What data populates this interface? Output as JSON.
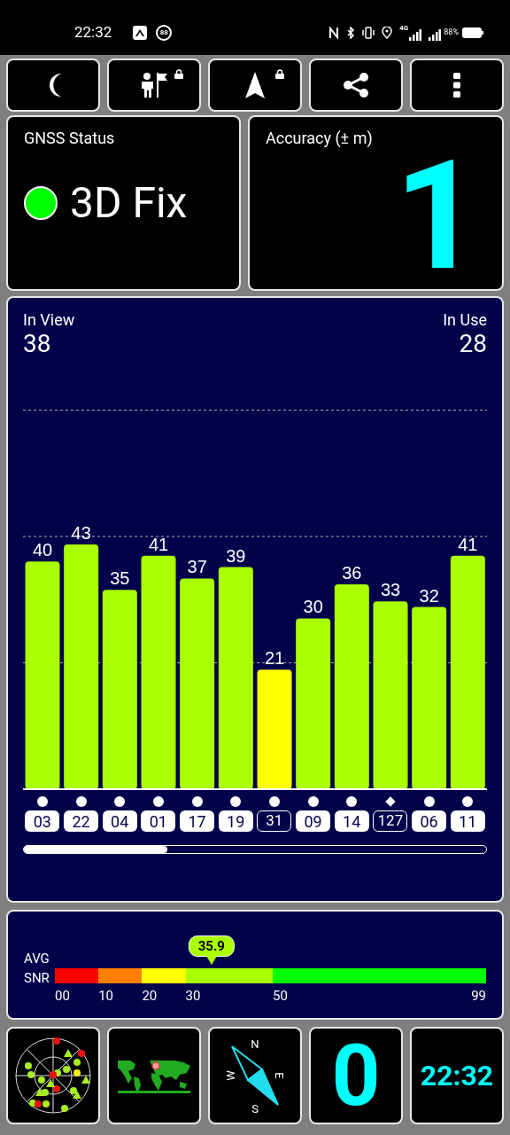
{
  "status_bar": {
    "time": "22:32",
    "notification_count": "88",
    "network": "4G",
    "battery": "88%"
  },
  "toolbar": [
    {
      "kind": "moon",
      "locked": false
    },
    {
      "kind": "person-flag",
      "locked": true
    },
    {
      "kind": "arrow",
      "locked": true
    },
    {
      "kind": "share",
      "locked": false
    },
    {
      "kind": "more",
      "locked": false
    }
  ],
  "gnss_status": {
    "title": "GNSS Status",
    "fix": "3D Fix"
  },
  "accuracy": {
    "title": "Accuracy (± m)",
    "value": "1"
  },
  "satellites": {
    "in_view_label": "In View",
    "in_view": "38",
    "in_use_label": "In Use",
    "in_use": "28",
    "chart_data": {
      "type": "bar",
      "categories": [
        "03",
        "22",
        "04",
        "01",
        "17",
        "19",
        "31",
        "09",
        "14",
        "127",
        "06",
        "11"
      ],
      "values": [
        40,
        43,
        35,
        41,
        37,
        39,
        21,
        30,
        36,
        33,
        32,
        41
      ],
      "data_labels": true
    },
    "list": [
      {
        "kind": "circle",
        "used": true
      },
      {
        "kind": "circle",
        "used": true
      },
      {
        "kind": "circle",
        "used": true
      },
      {
        "kind": "circle",
        "used": true
      },
      {
        "kind": "circle",
        "used": true
      },
      {
        "kind": "circle",
        "used": true
      },
      {
        "kind": "circle",
        "used": false
      },
      {
        "kind": "circle",
        "used": true
      },
      {
        "kind": "circle",
        "used": true
      },
      {
        "kind": "diamond",
        "used": false
      },
      {
        "kind": "circle",
        "used": true
      },
      {
        "kind": "circle",
        "used": true
      }
    ]
  },
  "snr": {
    "label_top": "AVG",
    "label_bottom": "SNR",
    "average": "35.9",
    "level": 0.363,
    "scale": [
      {
        "label": "00",
        "color": "#ff0000"
      },
      {
        "label": "10",
        "color": "#ff8000"
      },
      {
        "label": "20",
        "color": "#ffff00"
      },
      {
        "label": "30",
        "color": "#aaff00"
      },
      {
        "label": "50",
        "color": "#00ff00"
      },
      {
        "label": "99"
      }
    ]
  },
  "tiles": {
    "compass": [
      "N",
      "E",
      "S",
      "W"
    ],
    "speed": "0",
    "clock": "22:32"
  }
}
